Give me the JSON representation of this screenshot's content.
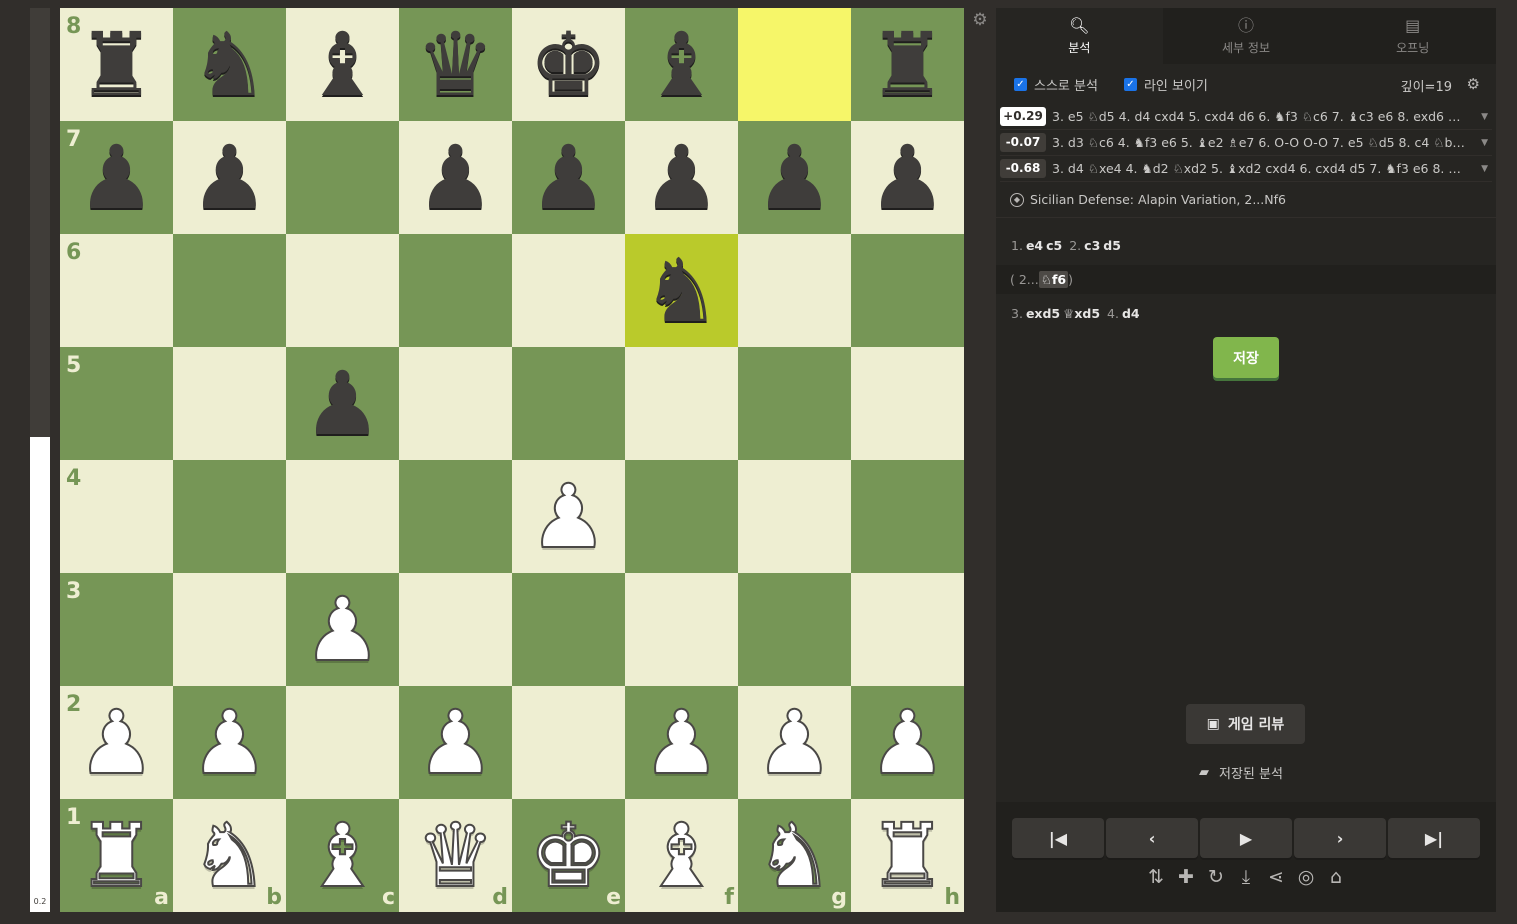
{
  "eval_bar": {
    "score": "0.2",
    "white_fraction": 0.525
  },
  "board": {
    "ranks": [
      "8",
      "7",
      "6",
      "5",
      "4",
      "3",
      "2",
      "1"
    ],
    "files": [
      "a",
      "b",
      "c",
      "d",
      "e",
      "f",
      "g",
      "h"
    ],
    "highlight": [
      "g8",
      "f6"
    ],
    "position": [
      [
        "r",
        "n",
        "b",
        "q",
        "k",
        "b",
        "",
        "r"
      ],
      [
        "p",
        "p",
        "",
        "p",
        "p",
        "p",
        "p",
        "p"
      ],
      [
        "",
        "",
        "",
        "",
        "",
        "n",
        "",
        ""
      ],
      [
        "",
        "",
        "p",
        "",
        "",
        "",
        "",
        ""
      ],
      [
        "",
        "",
        "",
        "",
        "P",
        "",
        "",
        ""
      ],
      [
        "",
        "",
        "P",
        "",
        "",
        "",
        "",
        ""
      ],
      [
        "P",
        "P",
        "",
        "P",
        "",
        "P",
        "P",
        "P"
      ],
      [
        "R",
        "N",
        "B",
        "Q",
        "K",
        "B",
        "N",
        "R"
      ]
    ],
    "gear_icon": "gear-icon"
  },
  "tabs": [
    {
      "label": "분석",
      "icon": "magnifier-icon",
      "active": true
    },
    {
      "label": "세부 정보",
      "icon": "info-icon",
      "active": false
    },
    {
      "label": "오프닝",
      "icon": "book-icon",
      "active": false
    }
  ],
  "options": {
    "self_analysis": "스스로 분석",
    "show_lines": "라인 보이기",
    "depth": "깊이=19"
  },
  "engine_lines": [
    {
      "score": "+0.29",
      "moves": "3. e5 ♘d5 4. d4 cxd4 5. cxd4 d6 6. ♞f3 ♘c6 7. ♝c3 e6 8. exd6 ♗xd6 9. ♞..."
    },
    {
      "score": "-0.07",
      "moves": "3. d3 ♘c6 4. ♞f3 e6 5. ♝e2 ♗e7 6. O-O O-O 7. e5 ♘d5 8. c4 ♘b6 9. ♞..."
    },
    {
      "score": "-0.68",
      "moves": "3. d4 ♘xe4 4. ♞d2 ♘xd2 5. ♝xd2 cxd4 6. cxd4 d5 7. ♞f3 e6 8. ♝d3 ♗d..."
    }
  ],
  "opening": "Sicilian Defense: Alapin Variation, 2...Nf6",
  "moves": {
    "row1": {
      "n1": "1.",
      "w1": "e4",
      "b1": "c5",
      "n2": "2.",
      "w2": "c3",
      "b2": "d5"
    },
    "variation": {
      "open": "( 2...",
      "move": "♘f6",
      "close": ")"
    },
    "row2": {
      "n3": "3.",
      "w3": "exd5",
      "b3": "♕xd5",
      "n4": "4.",
      "w4": "d4"
    }
  },
  "save_button": "저장",
  "game_review_button": "게임 리뷰",
  "saved_analysis": "저장된 분석",
  "nav": {
    "first": "|◀",
    "prev": "‹",
    "play": "▶",
    "next": "›",
    "last": "▶|"
  }
}
